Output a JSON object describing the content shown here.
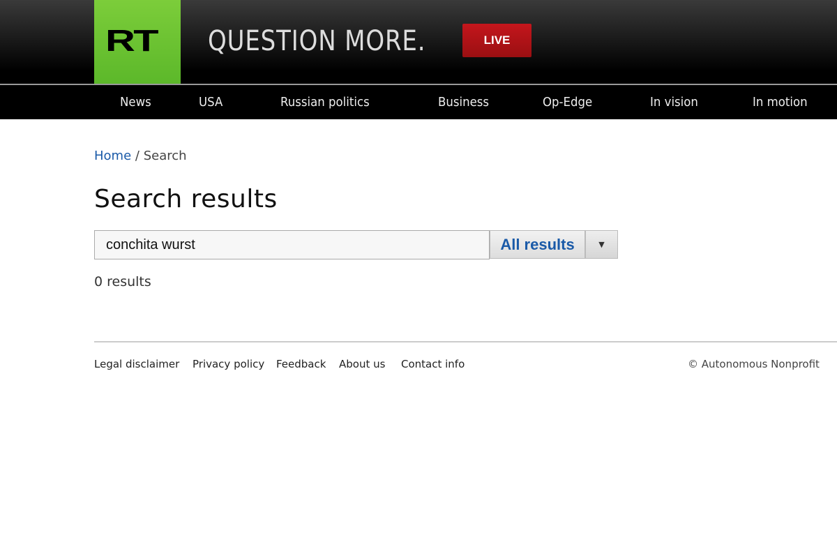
{
  "header": {
    "logo_text": "RT",
    "slogan": "QUESTION MORE.",
    "live_label": "LIVE",
    "brand_color": "#6cc433",
    "live_color": "#b31217"
  },
  "nav": {
    "items": [
      {
        "label": "News"
      },
      {
        "label": "USA"
      },
      {
        "label": "Russian politics"
      },
      {
        "label": "Business"
      },
      {
        "label": "Op-Edge"
      },
      {
        "label": "In vision"
      },
      {
        "label": "In motion"
      }
    ]
  },
  "breadcrumb": {
    "home": "Home",
    "separator": "/",
    "current": "Search"
  },
  "main": {
    "title": "Search results",
    "search_value": "conchita wurst",
    "filter_selected": "All results",
    "result_count": "0 results"
  },
  "footer": {
    "links": [
      {
        "label": "Legal disclaimer"
      },
      {
        "label": "Privacy policy"
      },
      {
        "label": "Feedback"
      },
      {
        "label": "About us"
      },
      {
        "label": "Contact info"
      }
    ],
    "copyright": "© Autonomous Nonprofit"
  }
}
